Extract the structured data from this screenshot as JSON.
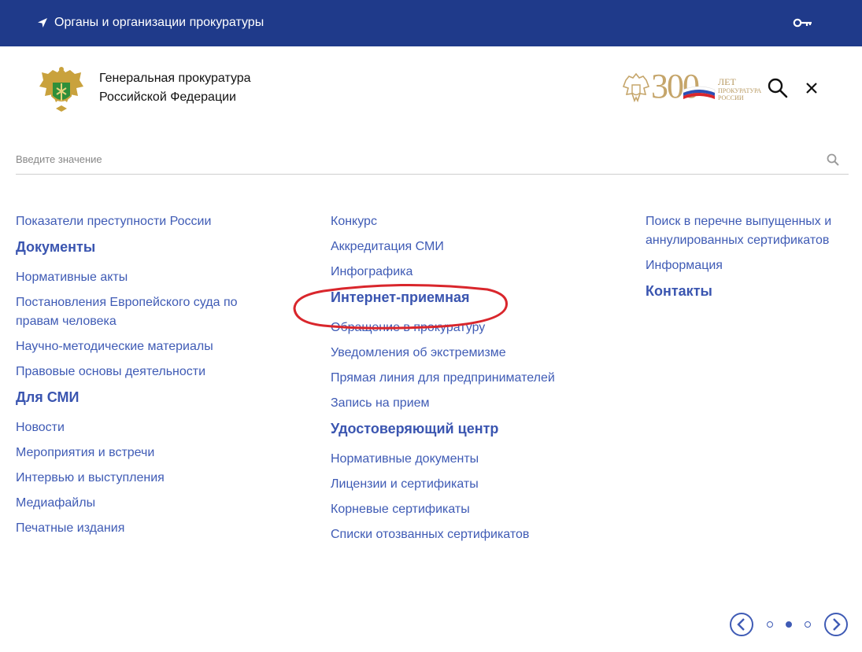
{
  "topbar": {
    "org_link": "Органы и организации прокуратуры",
    "bg_color": "#1f3a8a"
  },
  "header": {
    "title_line1": "Генеральная прокуратура",
    "title_line2": "Российской Федерации",
    "anniversary_number": "300",
    "anniversary_big": "ЛЕТ",
    "anniversary_small1": "ПРОКУРАТУРА",
    "anniversary_small2": "РОССИИ"
  },
  "search": {
    "placeholder": "Введите значение",
    "value": ""
  },
  "menu": {
    "col1": {
      "item_crime": "Показатели преступности России",
      "head_docs": "Документы",
      "item_norm_acts": "Нормативные акты",
      "item_echr_1": "Постановления Европейского суда по",
      "item_echr_2": "правам человека",
      "item_methodical": "Научно-методические материалы",
      "item_legal": "Правовые основы деятельности",
      "head_media": "Для СМИ",
      "item_news": "Новости",
      "item_events": "Мероприятия и встречи",
      "item_interviews": "Интервью и выступления",
      "item_mediafiles": "Медиафайлы",
      "item_print": "Печатные издания"
    },
    "col2": {
      "item_contest": "Конкурс",
      "item_accreditation": "Аккредитация СМИ",
      "item_infographics": "Инфографика",
      "head_reception": "Интернет-приемная",
      "item_appeal": "Обращение в прокуратуру",
      "item_extremism": "Уведомления об экстремизме",
      "item_hotline": "Прямая линия для предпринимателей",
      "item_appointment": "Запись на прием",
      "head_cert_center": "Удостоверяющий центр",
      "item_norm_docs": "Нормативные документы",
      "item_licenses": "Лицензии и сертификаты",
      "item_root_certs": "Корневые сертификаты",
      "item_revoked": "Списки отозванных сертификатов"
    },
    "col3": {
      "item_search_certs_1": "Поиск в перечне выпущенных и",
      "item_search_certs_2": "аннулированных сертификатов",
      "item_info": "Информация",
      "head_contacts": "Контакты"
    }
  },
  "pager": {
    "pages": 3,
    "active_page": 2
  },
  "colors": {
    "link": "#3f5bb5",
    "heading": "#3a55b0",
    "annotation": "#d9262c",
    "gold": "#c5a56a"
  }
}
